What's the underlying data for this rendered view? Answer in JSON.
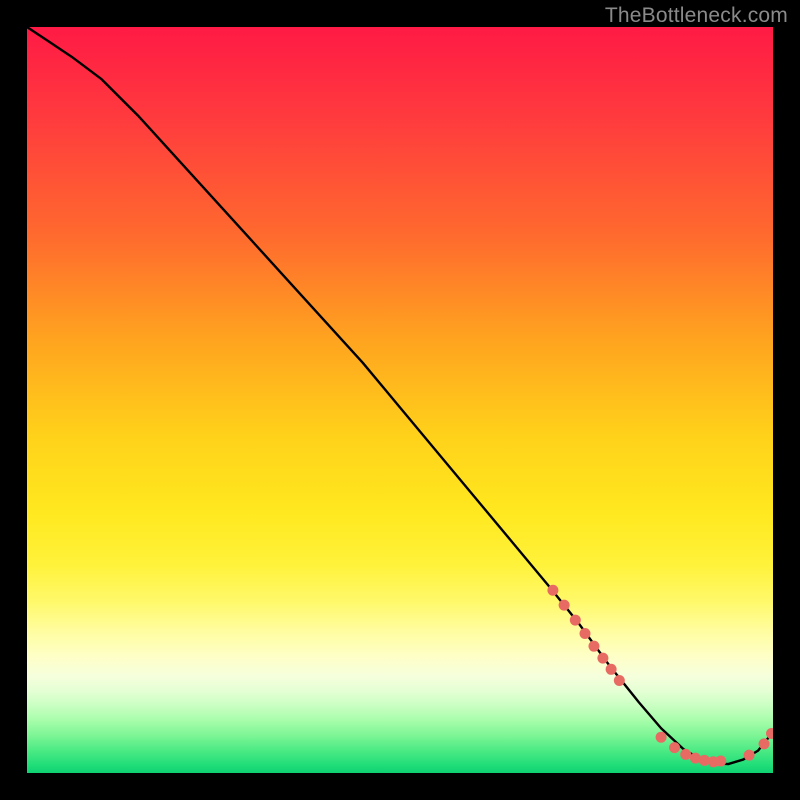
{
  "watermark": "TheBottleneck.com",
  "colors": {
    "curve": "#000000",
    "dots": "#e86b63",
    "plot_border": "#000000"
  },
  "chart_data": {
    "type": "line",
    "title": "",
    "xlabel": "",
    "ylabel": "",
    "xlim": [
      0,
      100
    ],
    "ylim": [
      0,
      100
    ],
    "grid": false,
    "legend": false,
    "series": [
      {
        "name": "bottleneck-curve",
        "x": [
          0,
          3,
          6,
          10,
          15,
          20,
          25,
          30,
          35,
          40,
          45,
          50,
          55,
          60,
          65,
          70,
          74,
          78,
          82,
          85,
          88,
          90,
          92,
          94,
          96,
          98,
          100
        ],
        "y": [
          100,
          98,
          96,
          93,
          88,
          82.5,
          77,
          71.5,
          66,
          60.5,
          55,
          49,
          43,
          37,
          31,
          25,
          20,
          14.5,
          9.5,
          6,
          3.2,
          2,
          1.3,
          1.2,
          1.8,
          3,
          5.5
        ]
      }
    ],
    "marker_clusters": [
      {
        "name": "descent-dots",
        "points": [
          {
            "x": 70.5,
            "y": 24.5
          },
          {
            "x": 72.0,
            "y": 22.5
          },
          {
            "x": 73.5,
            "y": 20.5
          },
          {
            "x": 74.8,
            "y": 18.7
          },
          {
            "x": 76.0,
            "y": 17.0
          },
          {
            "x": 77.2,
            "y": 15.4
          },
          {
            "x": 78.3,
            "y": 13.9
          },
          {
            "x": 79.4,
            "y": 12.4
          }
        ]
      },
      {
        "name": "floor-dots",
        "points": [
          {
            "x": 85.0,
            "y": 4.8
          },
          {
            "x": 86.8,
            "y": 3.4
          },
          {
            "x": 88.3,
            "y": 2.5
          },
          {
            "x": 89.6,
            "y": 2.0
          },
          {
            "x": 90.8,
            "y": 1.7
          },
          {
            "x": 92.0,
            "y": 1.5
          },
          {
            "x": 93.0,
            "y": 1.6
          }
        ]
      },
      {
        "name": "rise-dots",
        "points": [
          {
            "x": 96.8,
            "y": 2.4
          },
          {
            "x": 98.8,
            "y": 3.9
          },
          {
            "x": 99.8,
            "y": 5.3
          }
        ]
      }
    ]
  }
}
